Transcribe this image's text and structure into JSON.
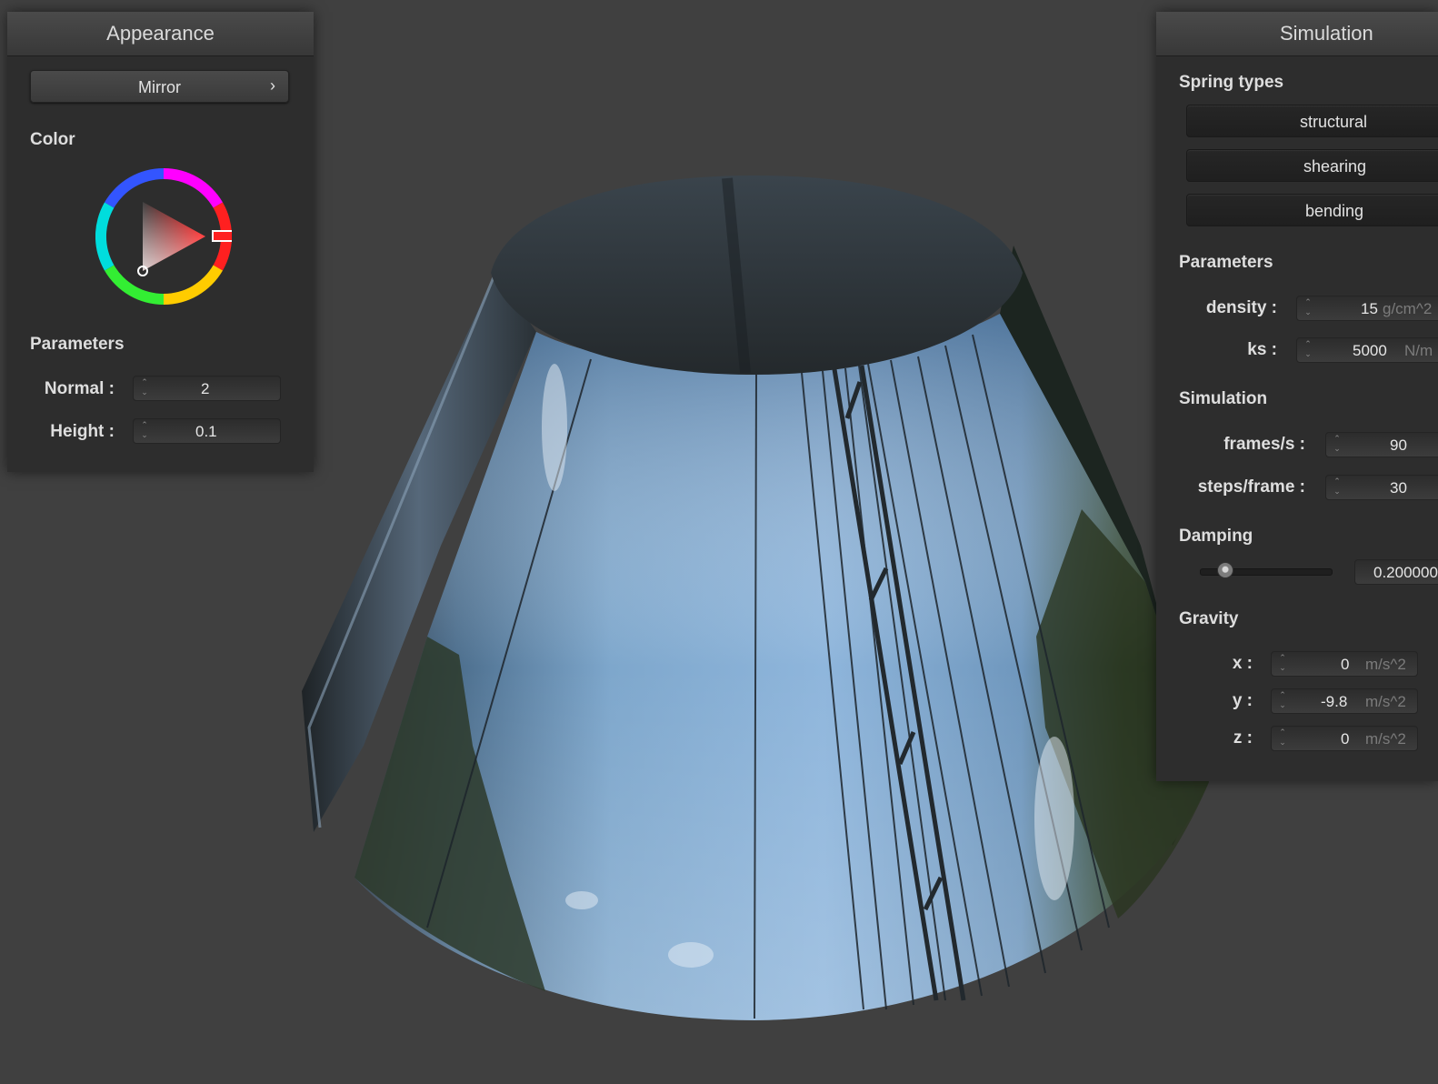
{
  "appearance": {
    "title": "Appearance",
    "shader_button": {
      "label": "Mirror",
      "chevron": "›"
    },
    "color_label": "Color",
    "color_picker": {
      "icon": "color-wheel-icon",
      "selected_hue": "#ff0000"
    },
    "parameters_label": "Parameters",
    "normal": {
      "label": "Normal :",
      "value": "2"
    },
    "height": {
      "label": "Height :",
      "value": "0.1"
    }
  },
  "simulation": {
    "title": "Simulation",
    "spring_types_label": "Spring types",
    "spring_buttons": [
      "structural",
      "shearing",
      "bending"
    ],
    "parameters_label": "Parameters",
    "density": {
      "label": "density :",
      "value": "15",
      "unit": "g/cm^2"
    },
    "ks": {
      "label": "ks :",
      "value": "5000",
      "unit": "N/m"
    },
    "simulation_label": "Simulation",
    "fps": {
      "label": "frames/s :",
      "value": "90"
    },
    "steps": {
      "label": "steps/frame :",
      "value": "30"
    },
    "damping_label": "Damping",
    "damping": {
      "slider_fraction": 0.2,
      "value": "0.200000"
    },
    "gravity_label": "Gravity",
    "gravity": {
      "x": {
        "label": "x :",
        "value": "0",
        "unit": "m/s^2"
      },
      "y": {
        "label": "y :",
        "value": "-9.8",
        "unit": "m/s^2"
      },
      "z": {
        "label": "z :",
        "value": "0",
        "unit": "m/s^2"
      }
    }
  }
}
